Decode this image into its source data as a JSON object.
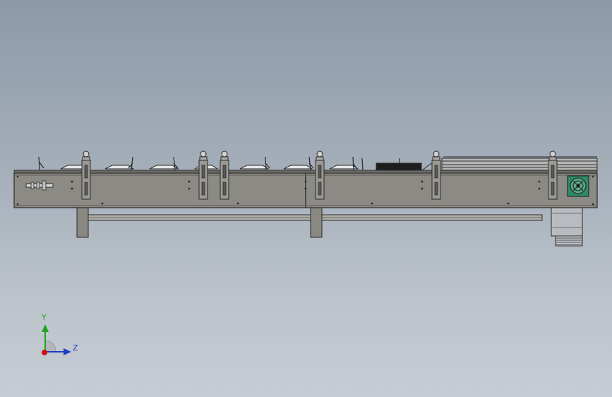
{
  "window": {
    "background_top": "#8c9aa8",
    "background_bottom": "#c6ccd3"
  },
  "model": {
    "frame_color": "#8c8a84",
    "outline_color": "#2a2a2a",
    "motor_color": "#b8bcc0",
    "fan_color": "#2e8b6a",
    "adjuster_count": 6,
    "product_count": 7
  },
  "triad": {
    "y_label": "Y",
    "z_label": "Z",
    "y_color": "#1fa31f",
    "z_color": "#1f3fbf",
    "x_color": "#d01010"
  }
}
